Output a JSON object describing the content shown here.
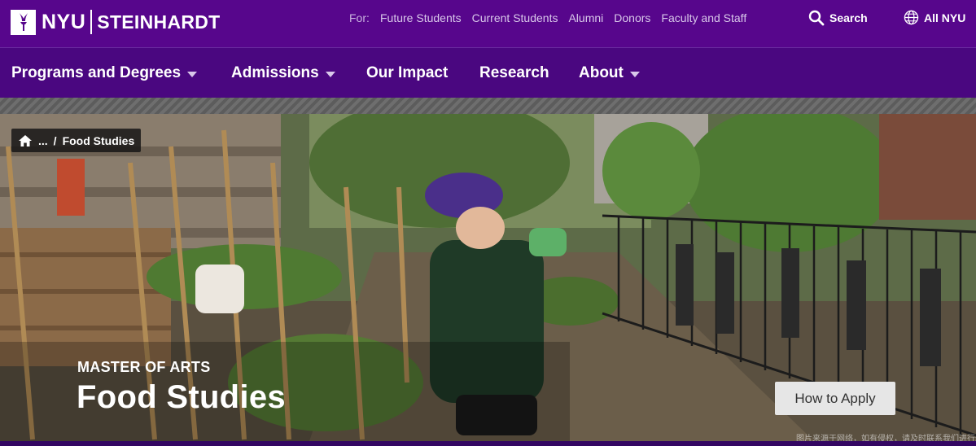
{
  "header": {
    "logo_nyu": "NYU",
    "logo_school": "STEINHARDT",
    "for_label": "For:",
    "audience_links": [
      "Future Students",
      "Current Students",
      "Alumni",
      "Donors",
      "Faculty and Staff"
    ],
    "search_label": "Search",
    "all_nyu_label": "All NYU"
  },
  "nav": {
    "items": [
      {
        "label": "Programs and Degrees",
        "has_menu": true
      },
      {
        "label": "Admissions",
        "has_menu": true
      },
      {
        "label": "Our Impact",
        "has_menu": false
      },
      {
        "label": "Research",
        "has_menu": false
      },
      {
        "label": "About",
        "has_menu": true
      }
    ]
  },
  "breadcrumb": {
    "ellipsis": "...",
    "separator": "/",
    "current": "Food Studies"
  },
  "hero": {
    "degree": "MASTER OF ARTS",
    "title": "Food Studies",
    "cta_label": "How to Apply",
    "watermark": "图片来源于网络，如有侵权，请及时联系我们进行删除"
  },
  "colors": {
    "brand_purple": "#57068c",
    "nav_purple": "#4a0780",
    "button_gray": "#e6e6e6"
  }
}
